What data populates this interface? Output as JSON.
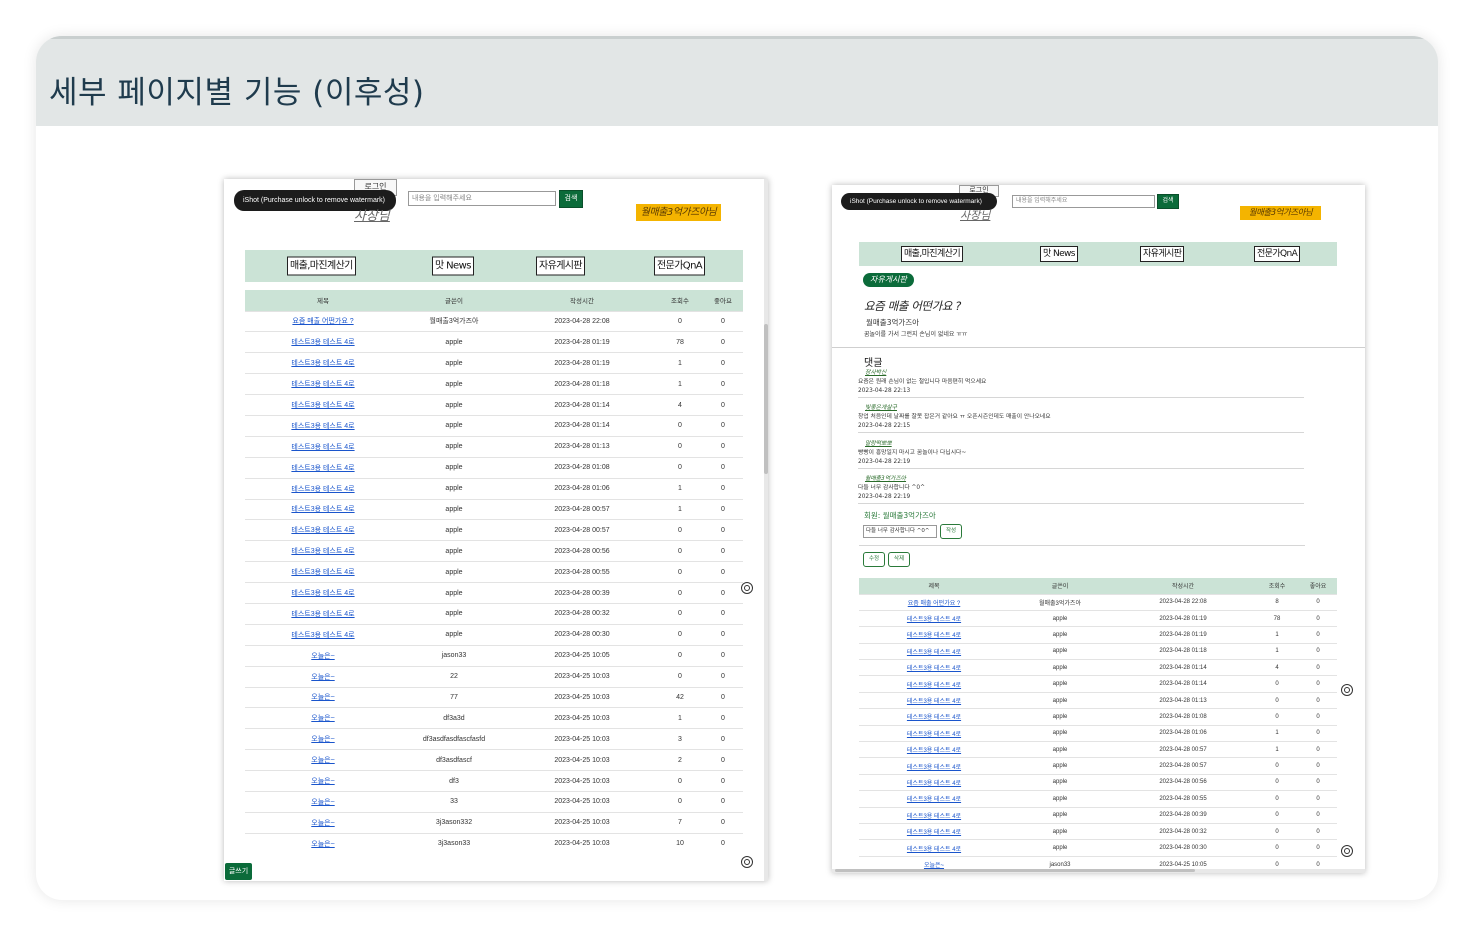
{
  "slide": {
    "title": "세부 페이지별 기능 (이후성)"
  },
  "left": {
    "watermark": "iShot (Purchase unlock to remove watermark)",
    "login_label": "로그인",
    "user_label": "사장님",
    "search_placeholder": "내용을 입력해주세요",
    "search_label": "검색",
    "brand": "월매출3억가즈아님",
    "nav": [
      "매출,마진계산기",
      "맛 News",
      "자유게시판",
      "전문가QnA"
    ],
    "table": {
      "headers": [
        "제목",
        "글쓴이",
        "작성시간",
        "조회수",
        "좋아요"
      ],
      "rows": [
        [
          "요즘 매출 어떤가요 ?",
          "월매출3억가즈아",
          "2023-04-28 22:08",
          "0",
          "0"
        ],
        [
          "테스트3용 테스트 4로",
          "apple",
          "2023-04-28 01:19",
          "78",
          "0"
        ],
        [
          "테스트3용 테스트 4로",
          "apple",
          "2023-04-28 01:19",
          "1",
          "0"
        ],
        [
          "테스트3용 테스트 4로",
          "apple",
          "2023-04-28 01:18",
          "1",
          "0"
        ],
        [
          "테스트3용 테스트 4로",
          "apple",
          "2023-04-28 01:14",
          "4",
          "0"
        ],
        [
          "테스트3용 테스트 4로",
          "apple",
          "2023-04-28 01:14",
          "0",
          "0"
        ],
        [
          "테스트3용 테스트 4로",
          "apple",
          "2023-04-28 01:13",
          "0",
          "0"
        ],
        [
          "테스트3용 테스트 4로",
          "apple",
          "2023-04-28 01:08",
          "0",
          "0"
        ],
        [
          "테스트3용 테스트 4로",
          "apple",
          "2023-04-28 01:06",
          "1",
          "0"
        ],
        [
          "테스트3용 테스트 4로",
          "apple",
          "2023-04-28 00:57",
          "1",
          "0"
        ],
        [
          "테스트3용 테스트 4로",
          "apple",
          "2023-04-28 00:57",
          "0",
          "0"
        ],
        [
          "테스트3용 테스트 4로",
          "apple",
          "2023-04-28 00:56",
          "0",
          "0"
        ],
        [
          "테스트3용 테스트 4로",
          "apple",
          "2023-04-28 00:55",
          "0",
          "0"
        ],
        [
          "테스트3용 테스트 4로",
          "apple",
          "2023-04-28 00:39",
          "0",
          "0"
        ],
        [
          "테스트3용 테스트 4로",
          "apple",
          "2023-04-28 00:32",
          "0",
          "0"
        ],
        [
          "테스트3용 테스트 4로",
          "apple",
          "2023-04-28 00:30",
          "0",
          "0"
        ],
        [
          "오늘은~",
          "jason33",
          "2023-04-25 10:05",
          "0",
          "0"
        ],
        [
          "오늘은~",
          "22",
          "2023-04-25 10:03",
          "0",
          "0"
        ],
        [
          "오늘은~",
          "77",
          "2023-04-25 10:03",
          "42",
          "0"
        ],
        [
          "오늘은~",
          "df3a3d",
          "2023-04-25 10:03",
          "1",
          "0"
        ],
        [
          "오늘은~",
          "df3asdfasdfascfasfd",
          "2023-04-25 10:03",
          "3",
          "0"
        ],
        [
          "오늘은~",
          "df3asdfascf",
          "2023-04-25 10:03",
          "2",
          "0"
        ],
        [
          "오늘은~",
          "df3",
          "2023-04-25 10:03",
          "0",
          "0"
        ],
        [
          "오늘은~",
          "33",
          "2023-04-25 10:03",
          "0",
          "0"
        ],
        [
          "오늘은~",
          "3j3ason332",
          "2023-04-25 10:03",
          "7",
          "0"
        ],
        [
          "오늘은~",
          "3j3ason33",
          "2023-04-25 10:03",
          "10",
          "0"
        ]
      ]
    },
    "write_label": "글쓰기"
  },
  "right": {
    "watermark": "iShot (Purchase unlock to remove watermark)",
    "login_label": "로그인",
    "user_label": "사장님",
    "search_placeholder": "내용을 입력해주세요",
    "search_label": "검색",
    "brand": "월매출3억가즈아님",
    "nav": [
      "매출,마진계산기",
      "맛 News",
      "자유게시판",
      "전문가QnA"
    ],
    "board_label": "자유게시판",
    "post": {
      "title": "요즘 매출 어떤가요 ?",
      "author": "월매출3억가즈아",
      "body": "꿈놀이를 가서 그런지 손님이 없네요 ㅠㅠ"
    },
    "comments_heading": "댓글",
    "comments": [
      {
        "author": "장사박신",
        "text": "요즘은 원래 손님이 없는 철입니다 마음편히 먹으세요",
        "time": "2023-04-28 22:13"
      },
      {
        "author": "빛좋은개살구",
        "text": "창업 처음인데 날짜를 잘못 잡은거 같아요 ㅠ 오픈시즌인데도 매출이 안나오네요",
        "time": "2023-04-28 22:15"
      },
      {
        "author": "말랑떡뽀뽀",
        "text": "빵빵이 흥망일지 마시고 꿈놀이나 다닙시다~",
        "time": "2023-04-28 22:19"
      },
      {
        "author": "월매출3억가즈아",
        "text": "다들 너무 감사합니다 ^0^",
        "time": "2023-04-28 22:19"
      }
    ],
    "member_label": "회원: 월매출3억가즈아",
    "comment_input_value": "다들 너무 감사합니다 ^0^",
    "comment_submit": "작성",
    "edit_label": "수정",
    "delete_label": "삭제",
    "table": {
      "headers": [
        "제목",
        "글쓴이",
        "작성시간",
        "조회수",
        "좋아요"
      ],
      "rows": [
        [
          "요즘 매출 어떤가요 ?",
          "월매출3억가즈아",
          "2023-04-28 22:08",
          "8",
          "0"
        ],
        [
          "테스트3용 테스트 4로",
          "apple",
          "2023-04-28 01:19",
          "78",
          "0"
        ],
        [
          "테스트3용 테스트 4로",
          "apple",
          "2023-04-28 01:19",
          "1",
          "0"
        ],
        [
          "테스트3용 테스트 4로",
          "apple",
          "2023-04-28 01:18",
          "1",
          "0"
        ],
        [
          "테스트3용 테스트 4로",
          "apple",
          "2023-04-28 01:14",
          "4",
          "0"
        ],
        [
          "테스트3용 테스트 4로",
          "apple",
          "2023-04-28 01:14",
          "0",
          "0"
        ],
        [
          "테스트3용 테스트 4로",
          "apple",
          "2023-04-28 01:13",
          "0",
          "0"
        ],
        [
          "테스트3용 테스트 4로",
          "apple",
          "2023-04-28 01:08",
          "0",
          "0"
        ],
        [
          "테스트3용 테스트 4로",
          "apple",
          "2023-04-28 01:06",
          "1",
          "0"
        ],
        [
          "테스트3용 테스트 4로",
          "apple",
          "2023-04-28 00:57",
          "1",
          "0"
        ],
        [
          "테스트3용 테스트 4로",
          "apple",
          "2023-04-28 00:57",
          "0",
          "0"
        ],
        [
          "테스트3용 테스트 4로",
          "apple",
          "2023-04-28 00:56",
          "0",
          "0"
        ],
        [
          "테스트3용 테스트 4로",
          "apple",
          "2023-04-28 00:55",
          "0",
          "0"
        ],
        [
          "테스트3용 테스트 4로",
          "apple",
          "2023-04-28 00:39",
          "0",
          "0"
        ],
        [
          "테스트3용 테스트 4로",
          "apple",
          "2023-04-28 00:32",
          "0",
          "0"
        ],
        [
          "테스트3용 테스트 4로",
          "apple",
          "2023-04-28 00:30",
          "0",
          "0"
        ],
        [
          "오늘은~",
          "jason33",
          "2023-04-25 10:05",
          "0",
          "0"
        ]
      ]
    }
  }
}
